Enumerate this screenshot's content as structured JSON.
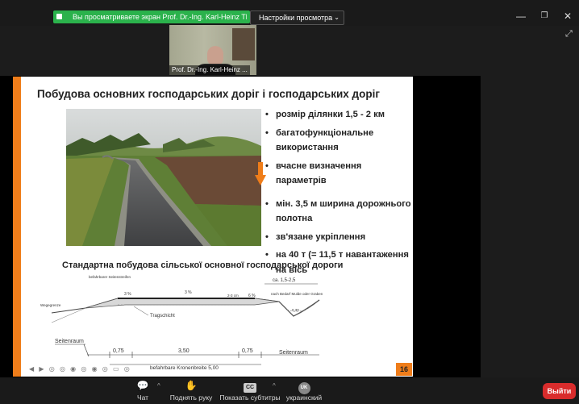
{
  "topbar": {
    "share_banner": "Вы просматриваете экран Prof. Dr.-Ing. Karl-Heinz Thie...",
    "view_options": "Настройки просмотра",
    "minimize": "—",
    "maximize": "❐",
    "close": "✕"
  },
  "video": {
    "name": "Prof. Dr.-Ing. Karl-Heinz ..."
  },
  "slide": {
    "title": "Побудова основних господарських доріг і господарських доріг",
    "bullets_top": [
      "розмір ділянки 1,5 - 2 км",
      "багатофункціональне використання",
      "вчасне визначення параметрів"
    ],
    "bullets_bottom": [
      "мін. 3,5 м ширина дорожнього полотна",
      "зв'язане укріплення",
      "на 40 т (= 11,5 т навантаження на вісь"
    ],
    "subtitle": "Стандартна побудова сільської основної господарської дороги",
    "page_number": "16",
    "diagram": {
      "label_shoulder": "befahrbarer Seitenstreifen",
      "label_border": "Wegegrenze",
      "label_base": "Tragschicht",
      "label_swale": "nach Bedarf Mulde oder Graben",
      "slope_left": "3 %",
      "slope_mid": "3 %",
      "slope_right": "6 %",
      "thick_mid": "2-3 cm",
      "right_width": "ca. 1,5-2,5",
      "depth": "0,30",
      "left_space": "Seitenraum",
      "right_space": "Seitenraum",
      "dim_left": "0,75",
      "dim_mid": "3,50",
      "dim_right": "0,75",
      "crown_width": "befahrbare Kronenbreite 5,00"
    }
  },
  "toolbar": {
    "chat": "Чат",
    "raise_hand": "Поднять руку",
    "show_subtitles": "Показать субтитры",
    "cc_badge": "CC",
    "language_badge": "UK",
    "language": "украинский",
    "exit": "Выйти"
  },
  "colors": {
    "accent_orange": "#ef7d1a",
    "share_green": "#2bb24c",
    "exit_red": "#d92c2c"
  }
}
